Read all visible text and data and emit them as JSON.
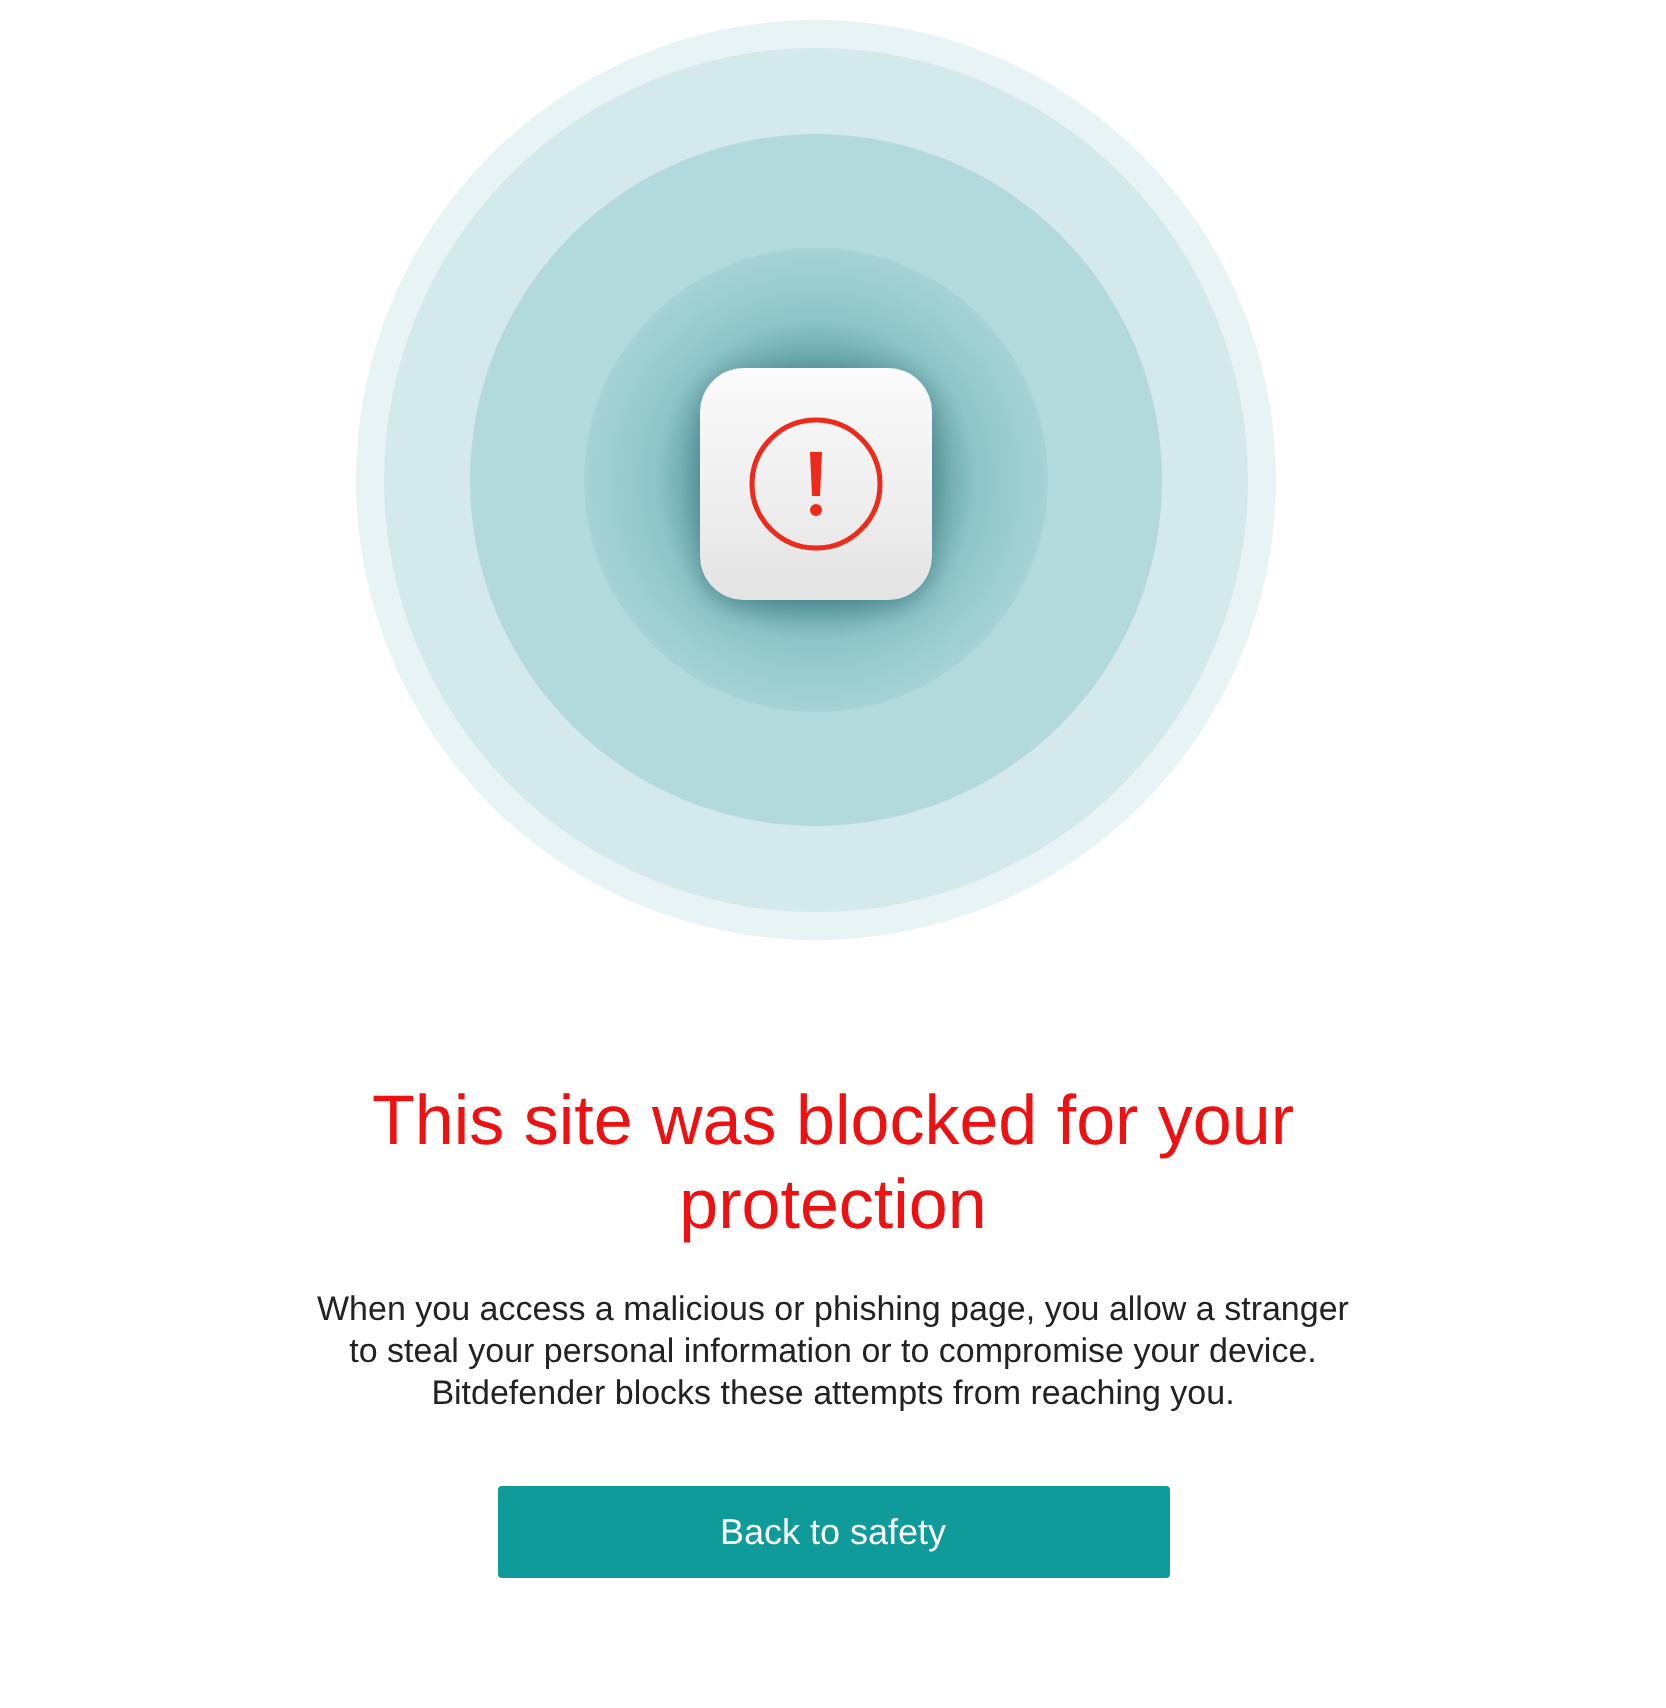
{
  "title": "This site was blocked for your protection",
  "message": "When you access a malicious or phishing page, you allow a stranger to steal your personal information or to compromise your device. Bitdefender blocks these attempts from reaching you.",
  "buttons": [
    {
      "label": "Back to safety"
    }
  ]
}
